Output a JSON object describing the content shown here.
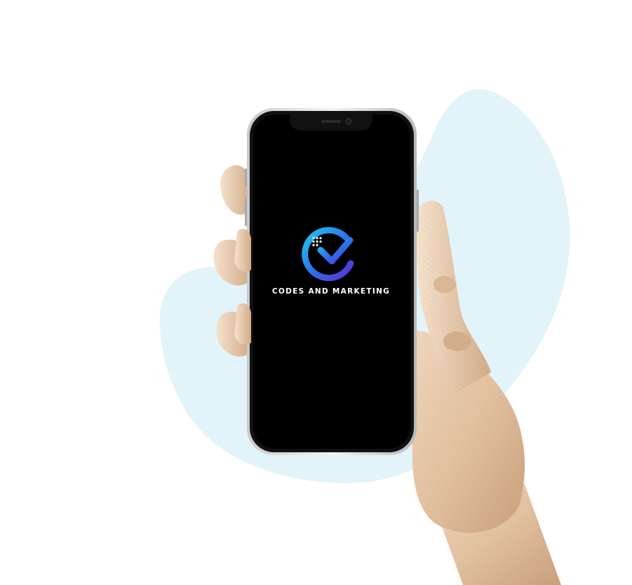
{
  "phone": {
    "brand_name": "CODES AND MARKETING",
    "logo": "cm-checkmark-circle-logo"
  },
  "scene": {
    "subject": "wooden-mannequin-hand-holding-smartphone",
    "backdrop_color": "#e3f3fa",
    "logo_gradient": [
      "#1ec8f0",
      "#2f6bea",
      "#5a2fd6"
    ]
  }
}
